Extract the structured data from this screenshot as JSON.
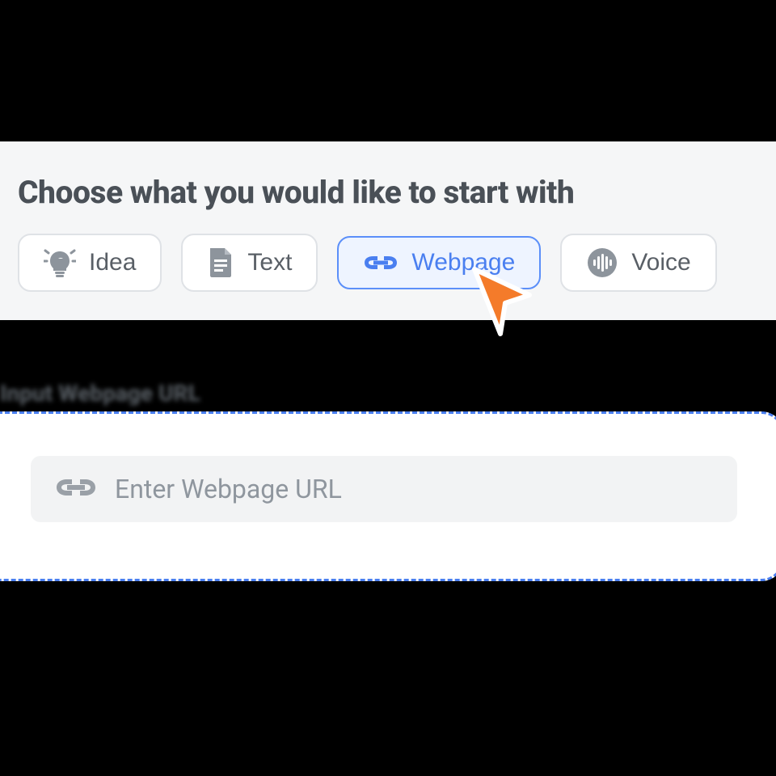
{
  "header": {
    "title": "Choose what you would like to start with"
  },
  "options": [
    {
      "label": "Idea",
      "icon": "lightbulb-icon"
    },
    {
      "label": "Text",
      "icon": "document-icon"
    },
    {
      "label": "Webpage",
      "icon": "link-icon",
      "selected": true
    },
    {
      "label": "Voice",
      "icon": "audio-icon"
    }
  ],
  "section": {
    "label": "Input Webpage URL"
  },
  "input": {
    "placeholder": "Enter Webpage URL"
  },
  "colors": {
    "accent": "#4a7ff0",
    "cursor": "#f47b2a"
  }
}
